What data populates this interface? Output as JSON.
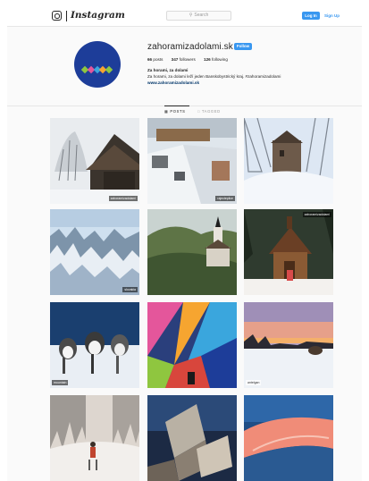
{
  "nav": {
    "brand": "Instagram",
    "search_placeholder": "Search",
    "login_label": "Log In",
    "signup_label": "Sign Up"
  },
  "profile": {
    "username": "zahoramizadolami.sk",
    "follow_label": "Follow",
    "posts": {
      "count": "66",
      "label": "posts"
    },
    "followers": {
      "count": "347",
      "label": "followers"
    },
    "following": {
      "count": "126",
      "label": "following"
    },
    "bio_name": "Za horami, za dolami",
    "bio_text": "Za horami, za dolami leží jeden Banskobystrický kraj. #zahoramizadolami",
    "website": "www.zahoramizadolami.sk",
    "avatar_colors": [
      "#8fc63f",
      "#e4569b",
      "#3aa6dd",
      "#f6a530",
      "#8fc63f"
    ]
  },
  "tabs": [
    {
      "label": "POSTS",
      "icon": "grid-icon",
      "active": true
    },
    {
      "label": "TAGGED",
      "icon": "tag-icon",
      "active": false
    }
  ],
  "posts": [
    {
      "scene": "wooden-church-winter",
      "tag": "zahoramizadolami",
      "tag_style": "dark"
    },
    {
      "scene": "snowy-town-aerial",
      "tag": "rajecteplice",
      "tag_style": "dark"
    },
    {
      "scene": "castle-snow",
      "tag": "",
      "tag_style": "dark"
    },
    {
      "scene": "frozen-trees",
      "tag": "slovakia",
      "tag_style": "dark"
    },
    {
      "scene": "church-valley",
      "tag": "",
      "tag_style": "dark"
    },
    {
      "scene": "wooden-chapel-snow",
      "tag": "zahoramizadolami",
      "tag_style": "dark"
    },
    {
      "scene": "husky-sled",
      "tag": "mountain",
      "tag_style": "dark"
    },
    {
      "scene": "hot-air-balloon",
      "tag": "",
      "tag_style": "dark"
    },
    {
      "scene": "winter-sunset",
      "tag": "antelgan",
      "tag_style": "light"
    },
    {
      "scene": "skier-forest",
      "tag": "",
      "tag_style": "dark"
    },
    {
      "scene": "modern-sculpture",
      "tag": "",
      "tag_style": "dark"
    },
    {
      "scene": "pink-mountain-ridge",
      "tag": "",
      "tag_style": "dark"
    }
  ]
}
